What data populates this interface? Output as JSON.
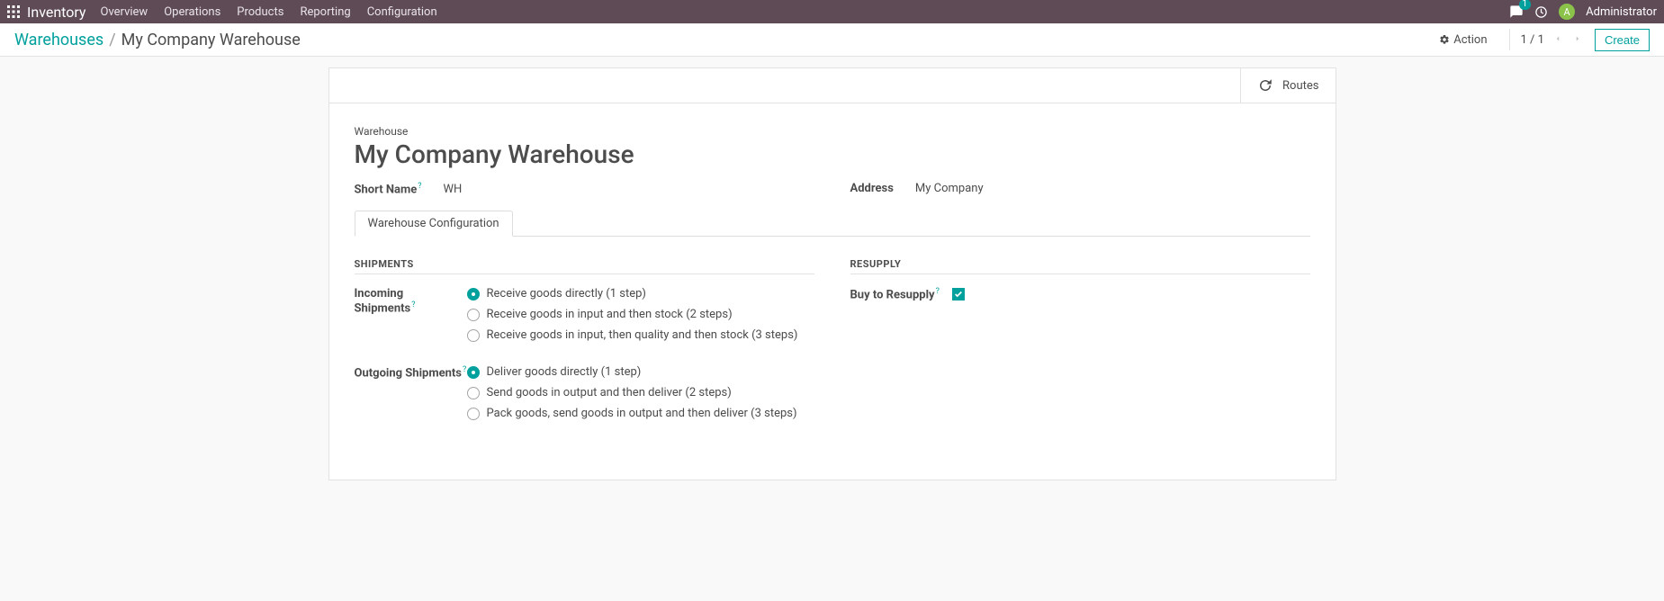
{
  "nav": {
    "brand": "Inventory",
    "menu": [
      "Overview",
      "Operations",
      "Products",
      "Reporting",
      "Configuration"
    ],
    "messages_count": "1",
    "user_initial": "A",
    "username": "Administrator"
  },
  "cp": {
    "breadcrumb_root": "Warehouses",
    "breadcrumb_current": "My Company Warehouse",
    "action_label": "Action",
    "pager": "1 / 1",
    "create_label": "Create"
  },
  "btnbar": {
    "routes_label": "Routes"
  },
  "form": {
    "title_label": "Warehouse",
    "title_value": "My Company Warehouse",
    "short_name_label": "Short Name",
    "short_name_value": "WH",
    "address_label": "Address",
    "address_value": "My Company",
    "tab_label": "Warehouse Configuration",
    "group_shipments": "SHIPMENTS",
    "group_resupply": "RESUPPLY",
    "incoming_label": "Incoming Shipments",
    "incoming_opts": [
      "Receive goods directly (1 step)",
      "Receive goods in input and then stock (2 steps)",
      "Receive goods in input, then quality and then stock (3 steps)"
    ],
    "outgoing_label": "Outgoing Shipments",
    "outgoing_opts": [
      "Deliver goods directly (1 step)",
      "Send goods in output and then deliver (2 steps)",
      "Pack goods, send goods in output and then deliver (3 steps)"
    ],
    "buy_label": "Buy to Resupply"
  }
}
